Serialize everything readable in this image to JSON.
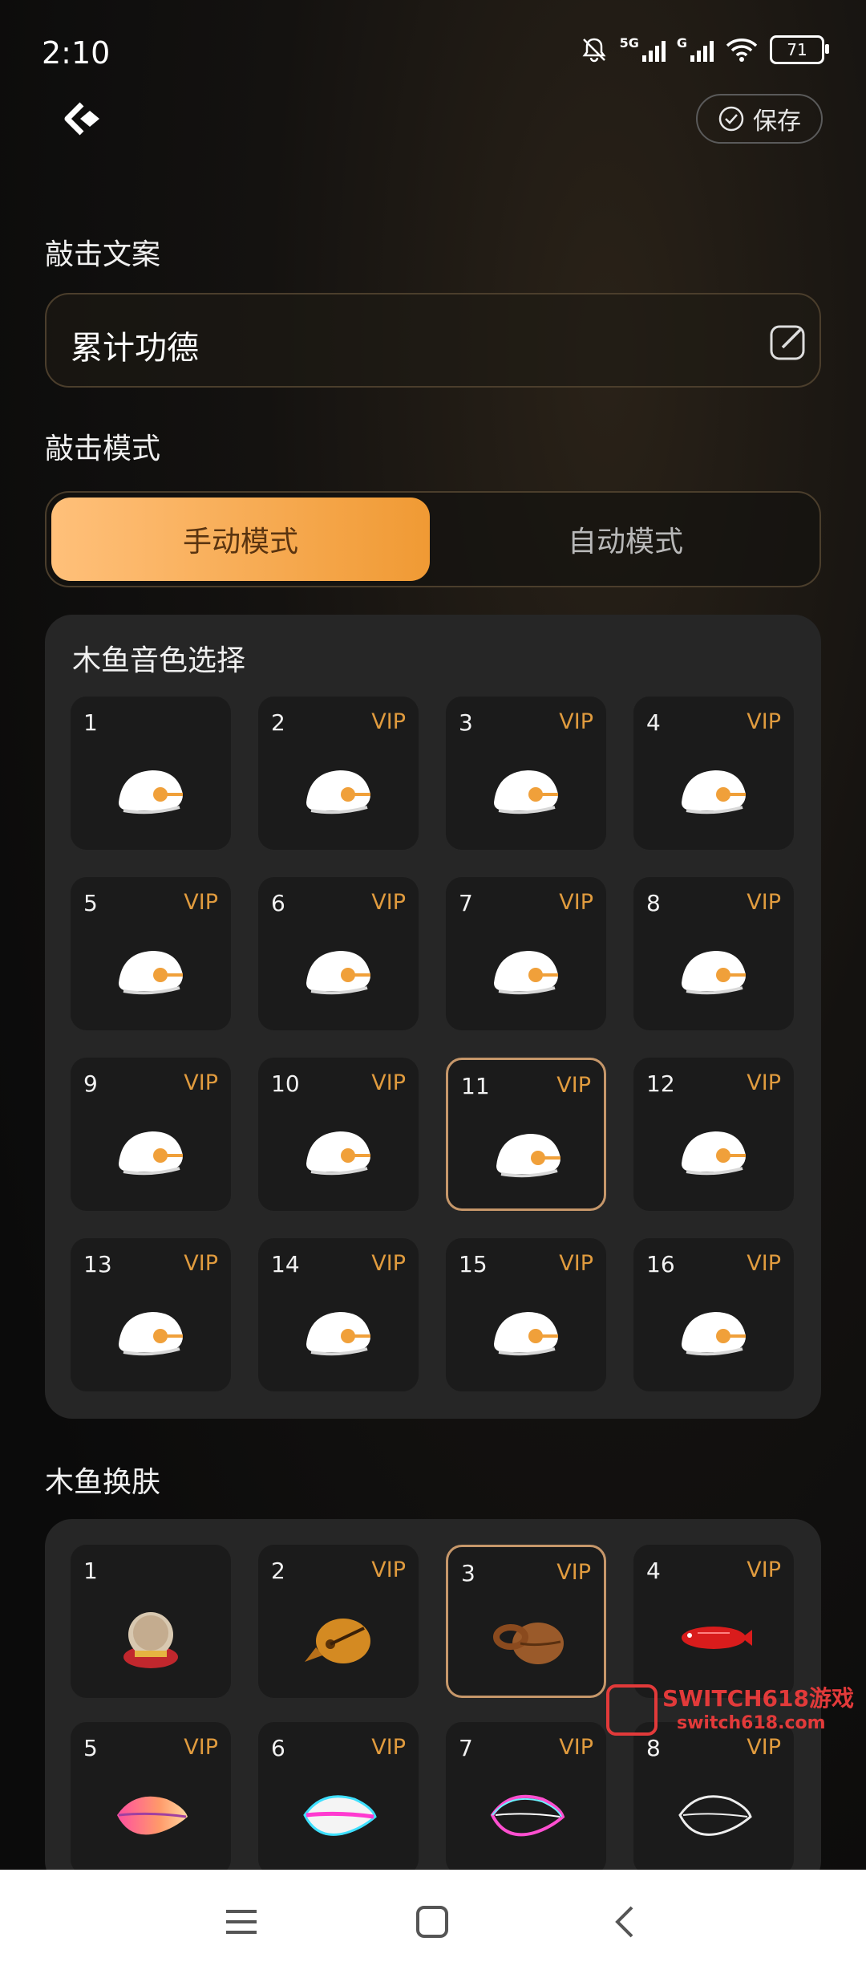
{
  "status_bar": {
    "time": "2:10",
    "network": "5G",
    "network2": "G",
    "battery": "71"
  },
  "header": {
    "save_label": "保存"
  },
  "strike_text": {
    "label": "敲击文案",
    "value": "累计功德"
  },
  "strike_mode": {
    "label": "敲击模式",
    "options": [
      "手动模式",
      "自动模式"
    ],
    "selected": "手动模式"
  },
  "sound_panel": {
    "title": "木鱼音色选择",
    "items": [
      {
        "num": "1",
        "vip": ""
      },
      {
        "num": "2",
        "vip": "VIP"
      },
      {
        "num": "3",
        "vip": "VIP"
      },
      {
        "num": "4",
        "vip": "VIP"
      },
      {
        "num": "5",
        "vip": "VIP"
      },
      {
        "num": "6",
        "vip": "VIP"
      },
      {
        "num": "7",
        "vip": "VIP"
      },
      {
        "num": "8",
        "vip": "VIP"
      },
      {
        "num": "9",
        "vip": "VIP"
      },
      {
        "num": "10",
        "vip": "VIP"
      },
      {
        "num": "11",
        "vip": "VIP"
      },
      {
        "num": "12",
        "vip": "VIP"
      },
      {
        "num": "13",
        "vip": "VIP"
      },
      {
        "num": "14",
        "vip": "VIP"
      },
      {
        "num": "15",
        "vip": "VIP"
      },
      {
        "num": "16",
        "vip": "VIP"
      }
    ],
    "selected": "11"
  },
  "skin_panel": {
    "title": "木鱼换肤",
    "items": [
      {
        "num": "1",
        "vip": "",
        "skin": "buddha"
      },
      {
        "num": "2",
        "vip": "VIP",
        "skin": "gold-fish"
      },
      {
        "num": "3",
        "vip": "VIP",
        "skin": "wood-fish"
      },
      {
        "num": "4",
        "vip": "VIP",
        "skin": "red-fish"
      },
      {
        "num": "5",
        "vip": "VIP",
        "skin": "gradient-shell"
      },
      {
        "num": "6",
        "vip": "VIP",
        "skin": "neon-shell"
      },
      {
        "num": "7",
        "vip": "VIP",
        "skin": "glow-outline"
      },
      {
        "num": "8",
        "vip": "VIP",
        "skin": "white-outline"
      }
    ],
    "selected": "3"
  },
  "watermark": {
    "title": "SWITCH618游戏",
    "sub": "switch618.com"
  },
  "colors": {
    "accent": "#f09a34",
    "vip": "#e09b3e",
    "selected_border": "#c6976a"
  }
}
